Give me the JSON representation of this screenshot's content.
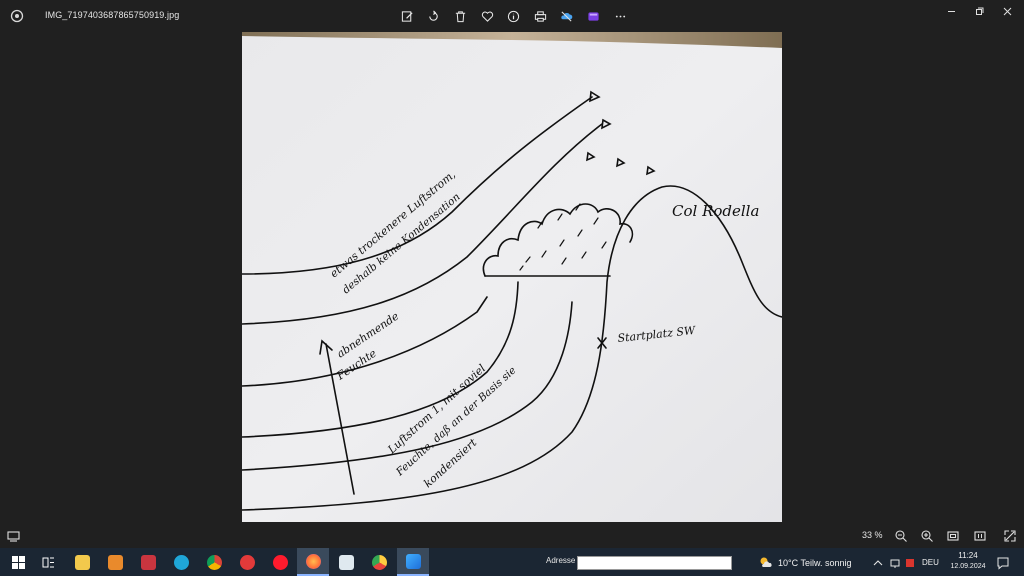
{
  "window": {
    "file_name": "IMG_7197403687865750919.jpg",
    "toolbar": [
      {
        "name": "edit-image-icon"
      },
      {
        "name": "rotate-icon"
      },
      {
        "name": "delete-icon"
      },
      {
        "name": "favorite-heart-icon"
      },
      {
        "name": "info-icon"
      },
      {
        "name": "print-icon"
      },
      {
        "name": "onedrive-icon"
      },
      {
        "name": "clipchamp-icon"
      },
      {
        "name": "more-icon"
      }
    ],
    "controls": [
      "minimize",
      "maximize",
      "close"
    ]
  },
  "image": {
    "drawing_labels": {
      "peak": "Col Rodella",
      "start": "Startplatz SW",
      "dry_line1": "etwas trockenere Luftstrom,",
      "dry_line2": "deshalb keine Kondensation",
      "humid_line1": "abnehmende",
      "humid_line2": "Feuchte",
      "flow_line1": "Luftstrom 1, mit soviel",
      "flow_line2": "Feuchte, daß an der Basis sie",
      "flow_line3": "kondensiert"
    }
  },
  "statusbar": {
    "zoom": "33 %",
    "buttons": [
      "zoom-out-icon",
      "zoom-in-icon",
      "fit-window-icon",
      "actual-size-icon",
      "fullscreen-icon"
    ]
  },
  "taskbar": {
    "address_label": "Adresse",
    "address_value": "",
    "weather": "10°C  Teilw. sonnig",
    "language": "DEU",
    "time": "11:24",
    "date": "12.09.2024",
    "colors": {
      "background": "#1b2633",
      "accent": "#8ab4ff"
    }
  }
}
